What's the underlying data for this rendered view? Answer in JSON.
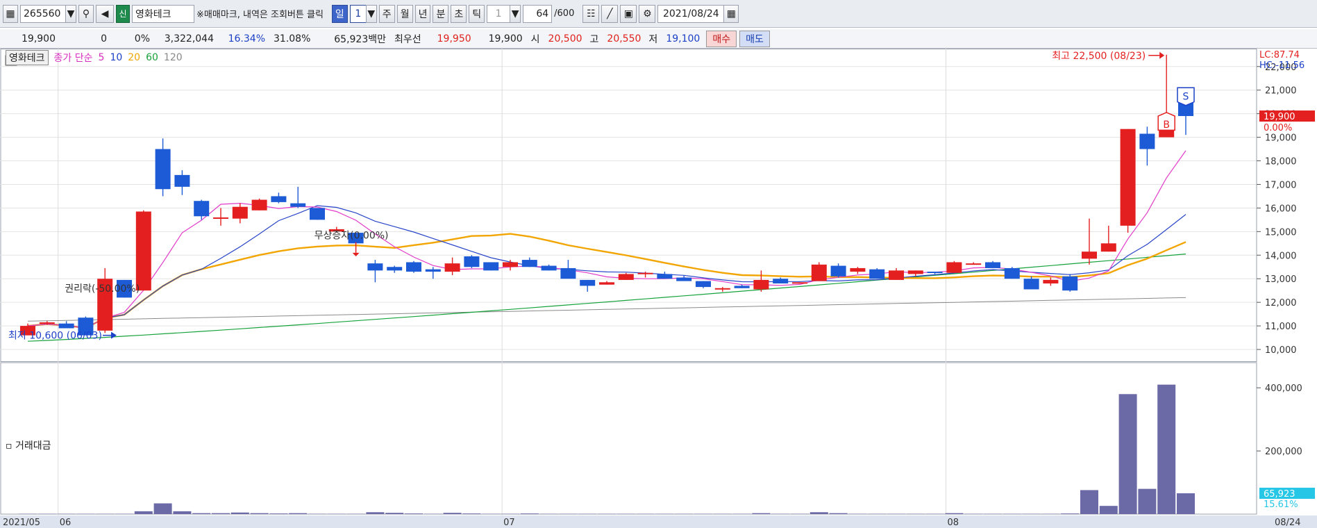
{
  "toolbar": {
    "code": "265560",
    "shin": "신",
    "name": "영화테크",
    "notice": "※매매마크, 내역은 조회버튼 클릭",
    "period_day": "일",
    "period_day_n": "1",
    "period_week": "주",
    "period_month": "월",
    "period_year": "년",
    "period_minute": "분",
    "period_second": "초",
    "period_tick": "틱",
    "tick_n": "1",
    "count": "64",
    "count_max": "/600",
    "date": "2021/08/24"
  },
  "quote": {
    "price": "19,900",
    "change": "0",
    "change_pct": "0%",
    "volume": "3,322,044",
    "pct1": "16.34%",
    "pct2": "31.08%",
    "amount": "65,923백만",
    "best_bid_label": "최우선",
    "best_ask": "19,950",
    "best_bid": "19,900",
    "open_label": "시",
    "open": "20,500",
    "high_label": "고",
    "high": "20,550",
    "low_label": "저",
    "low": "19,100",
    "buy_label": "매수",
    "sell_label": "매도"
  },
  "legend": {
    "name": "영화테크",
    "ma_title": "종가 단순",
    "ma5": "5",
    "ma10": "10",
    "ma20": "20",
    "ma60": "60",
    "ma120": "120"
  },
  "volume_label": "거래대금",
  "colors": {
    "up": "#e41f1f",
    "down": "#1d5bd6",
    "ma5": "#e23bc9",
    "ma10": "#2845c9",
    "ma20": "#f2a500",
    "ma60": "#16a23b",
    "ma120": "#8a8a8a",
    "volume": "#6c6aa6"
  },
  "chart_data": {
    "type": "candlestick",
    "y_axis": {
      "min": 9500,
      "max": 22700,
      "ticks": [
        10000,
        11000,
        12000,
        13000,
        14000,
        15000,
        16000,
        17000,
        18000,
        19000,
        20000,
        21000,
        22000
      ],
      "tick_labels": [
        "10,000",
        "11,000",
        "12,000",
        "13,000",
        "14,000",
        "15,000",
        "16,000",
        "17,000",
        "18,000",
        "19,000",
        "20,000",
        "21,000",
        "22,000"
      ]
    },
    "x_axis": {
      "labels": [
        "2021/05",
        "06",
        "07",
        "08",
        "08/24"
      ]
    },
    "price_flags": {
      "current": "19,900",
      "pct": "0.00%",
      "lc": "LC:87.74",
      "hc": "HC:-11.56"
    },
    "annotations": {
      "high": "최고 22,500 (08/23)",
      "low": "최저 10,600 (06/03)",
      "rights": "권리락(-50.00%)",
      "bonus": "무상증자(0.00%)",
      "buy_mark": "B",
      "sell_mark": "S"
    },
    "candles": [
      {
        "o": 10600,
        "h": 11100,
        "l": 10600,
        "c": 11000
      },
      {
        "o": 11100,
        "h": 11200,
        "l": 11050,
        "c": 11150
      },
      {
        "o": 11100,
        "h": 11200,
        "l": 10900,
        "c": 10900
      },
      {
        "o": 11350,
        "h": 11400,
        "l": 10600,
        "c": 10600
      },
      {
        "o": 10800,
        "h": 13450,
        "l": 10700,
        "c": 13000
      },
      {
        "o": 12950,
        "h": 12950,
        "l": 12200,
        "c": 12200
      },
      {
        "o": 12500,
        "h": 15900,
        "l": 12500,
        "c": 15850
      },
      {
        "o": 18500,
        "h": 18950,
        "l": 16500,
        "c": 16800
      },
      {
        "o": 17400,
        "h": 17600,
        "l": 16550,
        "c": 16900
      },
      {
        "o": 16300,
        "h": 16350,
        "l": 15500,
        "c": 15650
      },
      {
        "o": 15550,
        "h": 16000,
        "l": 15250,
        "c": 15600
      },
      {
        "o": 15550,
        "h": 16200,
        "l": 15350,
        "c": 16050
      },
      {
        "o": 15900,
        "h": 16400,
        "l": 15900,
        "c": 16350
      },
      {
        "o": 16500,
        "h": 16650,
        "l": 16200,
        "c": 16250
      },
      {
        "o": 16200,
        "h": 16900,
        "l": 16000,
        "c": 16050
      },
      {
        "o": 16000,
        "h": 16000,
        "l": 15500,
        "c": 15500
      },
      {
        "o": 15000,
        "h": 15200,
        "l": 15000,
        "c": 15100
      },
      {
        "o": 14950,
        "h": 14950,
        "l": 14500,
        "c": 14500
      },
      {
        "o": 13650,
        "h": 13800,
        "l": 12850,
        "c": 13350
      },
      {
        "o": 13500,
        "h": 13550,
        "l": 13250,
        "c": 13350
      },
      {
        "o": 13700,
        "h": 13750,
        "l": 13250,
        "c": 13300
      },
      {
        "o": 13400,
        "h": 13500,
        "l": 13000,
        "c": 13300
      },
      {
        "o": 13300,
        "h": 13900,
        "l": 13150,
        "c": 13650
      },
      {
        "o": 13950,
        "h": 14000,
        "l": 13450,
        "c": 13500
      },
      {
        "o": 13700,
        "h": 13700,
        "l": 13350,
        "c": 13350
      },
      {
        "o": 13500,
        "h": 13800,
        "l": 13350,
        "c": 13700
      },
      {
        "o": 13800,
        "h": 13900,
        "l": 13500,
        "c": 13500
      },
      {
        "o": 13550,
        "h": 13600,
        "l": 13350,
        "c": 13350
      },
      {
        "o": 13450,
        "h": 13800,
        "l": 13050,
        "c": 13000
      },
      {
        "o": 12950,
        "h": 12950,
        "l": 12450,
        "c": 12700
      },
      {
        "o": 12750,
        "h": 12900,
        "l": 12750,
        "c": 12850
      },
      {
        "o": 12950,
        "h": 13250,
        "l": 12950,
        "c": 13200
      },
      {
        "o": 13250,
        "h": 13300,
        "l": 13050,
        "c": 13250
      },
      {
        "o": 13200,
        "h": 13300,
        "l": 13050,
        "c": 13000
      },
      {
        "o": 13050,
        "h": 13150,
        "l": 12950,
        "c": 12900
      },
      {
        "o": 12900,
        "h": 12900,
        "l": 12600,
        "c": 12650
      },
      {
        "o": 12550,
        "h": 12650,
        "l": 12450,
        "c": 12600
      },
      {
        "o": 12700,
        "h": 12750,
        "l": 12600,
        "c": 12600
      },
      {
        "o": 12550,
        "h": 13350,
        "l": 12450,
        "c": 12950
      },
      {
        "o": 13000,
        "h": 13050,
        "l": 12800,
        "c": 12800
      },
      {
        "o": 12850,
        "h": 12850,
        "l": 12800,
        "c": 12850
      },
      {
        "o": 12900,
        "h": 13700,
        "l": 12900,
        "c": 13600
      },
      {
        "o": 13550,
        "h": 13650,
        "l": 13050,
        "c": 13100
      },
      {
        "o": 13300,
        "h": 13500,
        "l": 13200,
        "c": 13450
      },
      {
        "o": 13400,
        "h": 13450,
        "l": 13000,
        "c": 13000
      },
      {
        "o": 12950,
        "h": 13450,
        "l": 12950,
        "c": 13350
      },
      {
        "o": 13200,
        "h": 13350,
        "l": 13100,
        "c": 13350
      },
      {
        "o": 13300,
        "h": 13300,
        "l": 13200,
        "c": 13250
      },
      {
        "o": 13250,
        "h": 13750,
        "l": 13250,
        "c": 13700
      },
      {
        "o": 13650,
        "h": 13700,
        "l": 13600,
        "c": 13650
      },
      {
        "o": 13700,
        "h": 13750,
        "l": 13450,
        "c": 13450
      },
      {
        "o": 13450,
        "h": 13500,
        "l": 13000,
        "c": 13000
      },
      {
        "o": 13000,
        "h": 13100,
        "l": 12550,
        "c": 12550
      },
      {
        "o": 12800,
        "h": 13050,
        "l": 12700,
        "c": 12950
      },
      {
        "o": 13100,
        "h": 13200,
        "l": 12450,
        "c": 12500
      },
      {
        "o": 13850,
        "h": 15550,
        "l": 13600,
        "c": 14150
      },
      {
        "o": 14150,
        "h": 15250,
        "l": 14150,
        "c": 14500
      },
      {
        "o": 15250,
        "h": 19350,
        "l": 14950,
        "c": 19350
      },
      {
        "o": 19150,
        "h": 19450,
        "l": 17800,
        "c": 18500
      },
      {
        "o": 19000,
        "h": 22500,
        "l": 19000,
        "c": 19900
      },
      {
        "o": 20500,
        "h": 20550,
        "l": 19100,
        "c": 19900
      }
    ],
    "x_tick_index": {
      "06": 2,
      "07": 25,
      "08": 48
    },
    "volume_axis": {
      "max": 440000,
      "ticks": [
        200000,
        400000
      ],
      "tick_labels": [
        "200,000",
        "400,000"
      ]
    },
    "volume": [
      1000,
      1000,
      1000,
      1000,
      1000,
      1000,
      9000,
      34000,
      9000,
      3000,
      3000,
      5000,
      3000,
      2000,
      3000,
      1000,
      1000,
      1000,
      6000,
      4000,
      2000,
      1000,
      4000,
      2000,
      1000,
      1000,
      2000,
      1000,
      1000,
      1000,
      1000,
      1000,
      1000,
      1000,
      1000,
      1000,
      1000,
      1000,
      3000,
      1000,
      1000,
      6000,
      3000,
      1000,
      1000,
      1000,
      1000,
      1000,
      3000,
      1000,
      1000,
      1000,
      1000,
      1000,
      2000,
      76000,
      26000,
      380000,
      80000,
      410000,
      65923
    ],
    "volume_flags": {
      "current": "65,923",
      "pct": "15.61%"
    }
  }
}
